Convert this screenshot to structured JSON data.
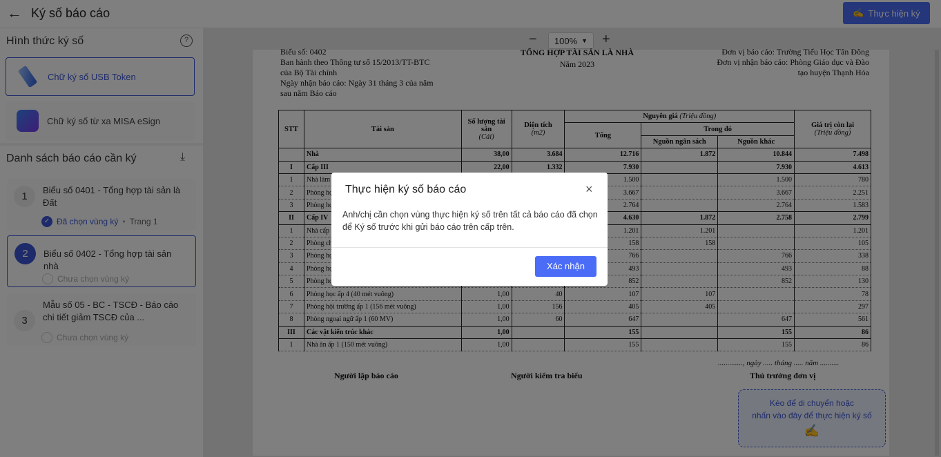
{
  "header": {
    "title": "Ký số báo cáo",
    "sign_button": "Thực hiện ký"
  },
  "left": {
    "method_title": "Hình thức ký số",
    "help": "?",
    "methods": [
      {
        "label": "Chữ ký số USB Token"
      },
      {
        "label": "Chữ ký số từ xa MISA eSign"
      }
    ],
    "list_title": "Danh sách báo cáo cần ký",
    "reports": [
      {
        "num": "1",
        "name": "Biểu số 0401 - Tổng hợp tài sản là Đất",
        "status": "Đã chọn vùng ký",
        "page": "Trang 1"
      },
      {
        "num": "2",
        "name": "Biểu số 0402 - Tổng hợp tài sản nhà",
        "status": "Chưa chọn vùng ký"
      },
      {
        "num": "3",
        "name": "Mẫu số 05 - BC - TSCĐ - Báo cáo chi tiết giảm TSCĐ của ...",
        "status": "Chưa chọn vùng ký"
      }
    ]
  },
  "toolbar": {
    "zoom": "100%",
    "minus": "−",
    "plus": "+"
  },
  "doc": {
    "left_lines": [
      "Biểu số: 0402",
      "Ban hành theo Thông tư số 15/2013/TT-BTC",
      "của Bộ Tài chính",
      "Ngày nhận báo cáo: Ngày 31 tháng 3 của năm",
      "sau năm Báo cáo"
    ],
    "center_lines": [
      "TỔNG HỢP TÀI SẢN LÀ NHÀ",
      "Năm 2023"
    ],
    "right_lines": [
      "Đơn vị báo cáo: Trường Tiểu Học Tân Đông",
      "Đơn vị nhận báo cáo: Phòng Giáo dục và Đào",
      "tạo huyện Thạnh Hóa"
    ],
    "headers": {
      "stt": "STT",
      "asset": "Tài sản",
      "qty": "Số lượng tài sản",
      "qty_unit": "(Cái)",
      "area": "Diện tích",
      "area_unit": "(m2)",
      "orig": "Nguyên giá",
      "orig_unit": "(Triệu đồng)",
      "total": "Tổng",
      "of_which": "Trong đó",
      "budget": "Nguồn ngân sách",
      "other": "Nguồn khác",
      "remain": "Giá trị còn lại",
      "remain_unit": "(Triệu đồng)"
    },
    "rows": [
      {
        "b": true,
        "stt": "",
        "name": "Nhà",
        "qty": "38,00",
        "area": "3.684",
        "total": "12.716",
        "budget": "1.872",
        "other": "10.844",
        "remain": "7.498"
      },
      {
        "b": true,
        "stt": "I",
        "name": "Cấp III",
        "qty": "22,00",
        "area": "1.332",
        "total": "7.930",
        "budget": "",
        "other": "7.930",
        "remain": "4.613"
      },
      {
        "stt": "1",
        "name": "Nhà làm",
        "qty": "",
        "area": "",
        "total": "1.500",
        "budget": "",
        "other": "1.500",
        "remain": "780"
      },
      {
        "stt": "2",
        "name": "Phòng họ",
        "qty": "",
        "area": "",
        "total": "3.667",
        "budget": "",
        "other": "3.667",
        "remain": "2.251"
      },
      {
        "stt": "3",
        "name": "Phòng họ",
        "qty": "",
        "area": "",
        "total": "2.764",
        "budget": "",
        "other": "2.764",
        "remain": "1.583"
      },
      {
        "b": true,
        "stt": "II",
        "name": "Cấp IV",
        "qty": "",
        "area": "",
        "total": "4.630",
        "budget": "1.872",
        "other": "2.758",
        "remain": "2.799"
      },
      {
        "stt": "1",
        "name": "Nhà cấp",
        "qty": "",
        "area": "",
        "total": "1.201",
        "budget": "1.201",
        "other": "",
        "remain": "1.201"
      },
      {
        "stt": "2",
        "name": "Phòng ch",
        "qty": "",
        "area": "",
        "total": "158",
        "budget": "158",
        "other": "",
        "remain": "105"
      },
      {
        "stt": "3",
        "name": "Phòng họ",
        "qty": "",
        "area": "",
        "total": "766",
        "budget": "",
        "other": "766",
        "remain": "338"
      },
      {
        "stt": "4",
        "name": "Phòng họ",
        "qty": "",
        "area": "",
        "total": "493",
        "budget": "",
        "other": "493",
        "remain": "88"
      },
      {
        "stt": "5",
        "name": "Phòng họ",
        "qty": "",
        "area": "",
        "total": "852",
        "budget": "",
        "other": "852",
        "remain": "130"
      },
      {
        "stt": "6",
        "name": "Phòng học ấp 4 (40 mét vuông)",
        "qty": "1,00",
        "area": "40",
        "total": "107",
        "budget": "107",
        "other": "",
        "remain": "78"
      },
      {
        "stt": "7",
        "name": "Phòng hội trường ấp 1 (156 mét vuông)",
        "qty": "1,00",
        "area": "156",
        "total": "405",
        "budget": "405",
        "other": "",
        "remain": "297"
      },
      {
        "stt": "8",
        "name": "Phòng ngoại ngữ ấp 1 (60 MV)",
        "qty": "1,00",
        "area": "60",
        "total": "647",
        "budget": "",
        "other": "647",
        "remain": "561"
      },
      {
        "b": true,
        "stt": "III",
        "name": "Các vật kiến trúc khác",
        "qty": "1,00",
        "area": "",
        "total": "155",
        "budget": "",
        "other": "155",
        "remain": "86"
      },
      {
        "stt": "1",
        "name": "Nhà ăn ấp 1 (150 mét vuông)",
        "qty": "1,00",
        "area": "",
        "total": "155",
        "budget": "",
        "other": "155",
        "remain": "86"
      }
    ],
    "date_line": "............., ngày ..... tháng ..... năm ..........",
    "signers": [
      "Người lập báo cáo",
      "Người kiểm tra biểu",
      "Thủ trưởng đơn vị"
    ],
    "sign_zone": [
      "Kéo để di chuyển hoặc",
      "nhấn vào đây để thực hiện ký số"
    ]
  },
  "modal": {
    "title": "Thực hiện ký số báo cáo",
    "body": "Anh/chị cần chọn vùng thực hiện ký số trên tất cả báo cáo đã chọn để Ký số trước khi gửi báo cáo trên cấp trên.",
    "confirm": "Xác nhận",
    "close": "×"
  },
  "colors": {
    "accent": "#4a6cf7"
  }
}
